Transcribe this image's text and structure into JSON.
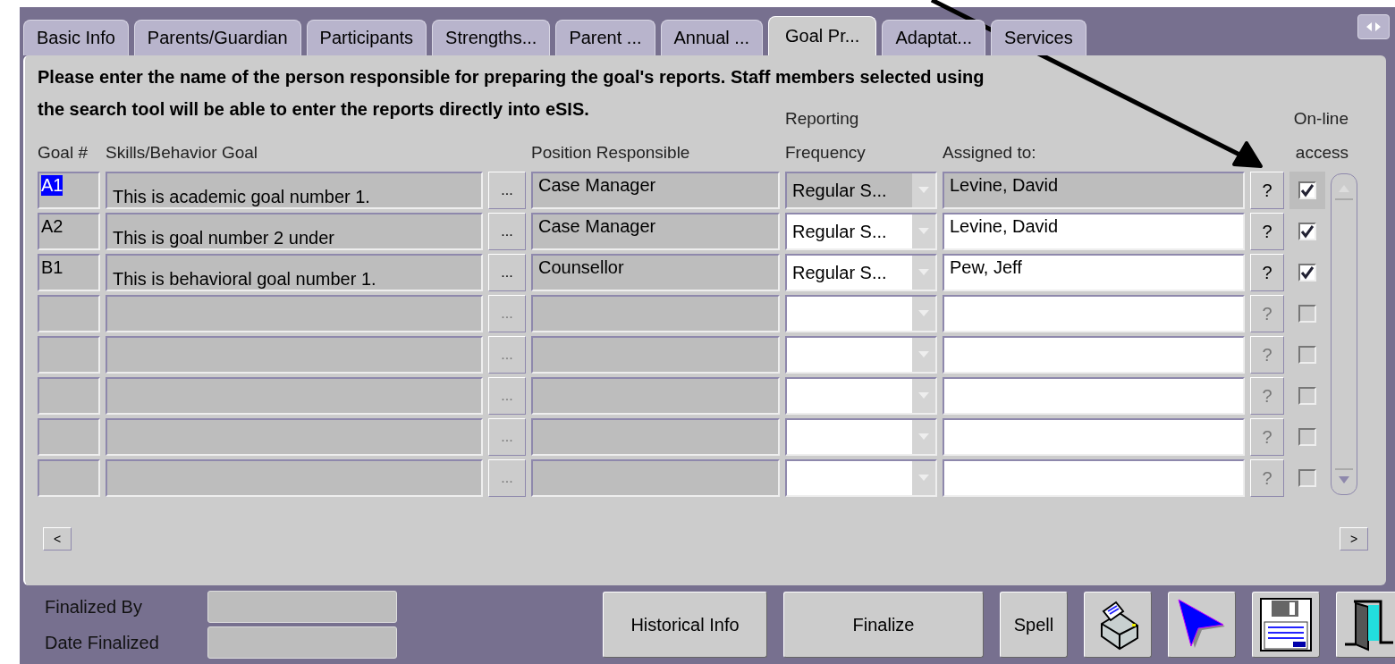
{
  "tabs": [
    {
      "label": "Basic Info",
      "selected": false
    },
    {
      "label": "Parents/Guardian",
      "selected": false
    },
    {
      "label": "Participants",
      "selected": false
    },
    {
      "label": "Strengths...",
      "selected": false
    },
    {
      "label": "Parent ...",
      "selected": false
    },
    {
      "label": "Annual ...",
      "selected": false
    },
    {
      "label": "Goal Pr...",
      "selected": true
    },
    {
      "label": "Adaptat...",
      "selected": false
    },
    {
      "label": "Services",
      "selected": false
    }
  ],
  "instruction": [
    "Please enter the name of the person responsible for preparing the goal's reports. Staff members selected using",
    "the search tool will be able to enter the reports directly into eSIS."
  ],
  "columns": {
    "goal_number": "Goal #",
    "goal": "Skills/Behavior Goal",
    "position": "Position Responsible",
    "frequency": [
      "Reporting",
      "Frequency"
    ],
    "assigned_to": "Assigned to:",
    "online_access": [
      "On-line",
      "access"
    ]
  },
  "rows": [
    {
      "selected": true,
      "goal_number": "A1",
      "goal": "This is academic goal number 1.",
      "position": "Case Manager",
      "frequency": "Regular S...",
      "assigned_to": "Levine, David",
      "disabled": false,
      "checked": true
    },
    {
      "selected": false,
      "goal_number": "A2",
      "goal": "This is goal number 2 under",
      "position": "Case Manager",
      "frequency": "Regular S...",
      "assigned_to": "Levine, David",
      "disabled": false,
      "checked": true
    },
    {
      "selected": false,
      "goal_number": "B1",
      "goal": "This is behavioral goal number 1.",
      "position": "Counsellor",
      "frequency": "Regular S...",
      "assigned_to": "Pew, Jeff",
      "disabled": false,
      "checked": true
    },
    {
      "selected": false,
      "disabled": true,
      "checked": false
    },
    {
      "selected": false,
      "disabled": true,
      "checked": false
    },
    {
      "selected": false,
      "disabled": true,
      "checked": false
    },
    {
      "selected": false,
      "disabled": true,
      "checked": false
    },
    {
      "selected": false,
      "disabled": true,
      "checked": false
    }
  ],
  "ellipsis_label": "...",
  "lookup_label": "?",
  "nav": {
    "prev": "<",
    "next": ">"
  },
  "footer": {
    "fields": [
      {
        "label": "Finalized By"
      },
      {
        "label": "Date Finalized"
      }
    ],
    "buttons": [
      {
        "label": "Historical Info",
        "kind": "text"
      },
      {
        "label": "Finalize",
        "kind": "text"
      },
      {
        "label": "Spell",
        "kind": "text"
      },
      {
        "kind": "print"
      },
      {
        "kind": "pointer"
      },
      {
        "kind": "save"
      },
      {
        "kind": "exit"
      }
    ]
  }
}
